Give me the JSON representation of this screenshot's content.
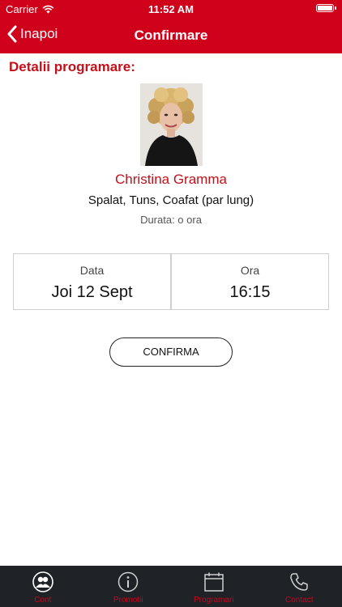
{
  "status_bar": {
    "carrier": "Carrier",
    "time": "11:52 AM",
    "battery_level": 1.0
  },
  "nav": {
    "back_label": "Inapoi",
    "title": "Confirmare"
  },
  "details": {
    "section_title": "Detalii programare:",
    "stylist_name": "Christina Gramma",
    "service": "Spalat, Tuns, Coafat (par lung)",
    "duration": "Durata: o ora"
  },
  "appointment": {
    "date_label": "Data",
    "date_value": "Joi 12 Sept",
    "time_label": "Ora",
    "time_value": "16:15"
  },
  "confirm_label": "CONFIRMA",
  "tabs": [
    {
      "label": "Cont",
      "icon": "account-icon"
    },
    {
      "label": "Promotii",
      "icon": "info-icon"
    },
    {
      "label": "Programari",
      "icon": "calendar-icon"
    },
    {
      "label": "Contact",
      "icon": "phone-icon"
    }
  ],
  "colors": {
    "brand_red": "#d0021b",
    "tab_bar": "#1f2226"
  }
}
